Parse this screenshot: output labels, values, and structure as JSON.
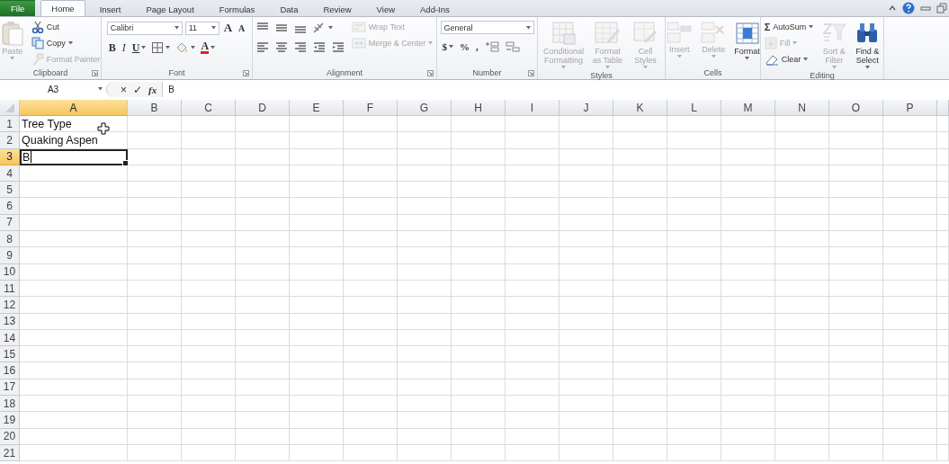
{
  "tabs": [
    {
      "label": "File",
      "kind": "file",
      "selected": false
    },
    {
      "label": "Home",
      "kind": "tab",
      "selected": true
    },
    {
      "label": "Insert",
      "kind": "tab",
      "selected": false
    },
    {
      "label": "Page Layout",
      "kind": "tab",
      "selected": false
    },
    {
      "label": "Formulas",
      "kind": "tab",
      "selected": false
    },
    {
      "label": "Data",
      "kind": "tab",
      "selected": false
    },
    {
      "label": "Review",
      "kind": "tab",
      "selected": false
    },
    {
      "label": "View",
      "kind": "tab",
      "selected": false
    },
    {
      "label": "Add-Ins",
      "kind": "tab",
      "selected": false
    }
  ],
  "ribbon": {
    "groups": [
      {
        "label": "Clipboard",
        "launcher": true,
        "columns": [
          {
            "kind": "large",
            "label": "Paste",
            "menu": true,
            "disabled": true
          },
          {
            "kind": "stack",
            "items": [
              {
                "label": "Cut",
                "menu": false,
                "disabled": false
              },
              {
                "label": "Copy",
                "menu": true,
                "disabled": false
              },
              {
                "label": "Format Painter",
                "menu": false,
                "disabled": true
              }
            ]
          }
        ]
      },
      {
        "label": "Font",
        "launcher": true,
        "columns": [
          {
            "kind": "rows",
            "rows": [
              {
                "controls": [
                  {
                    "kind": "combo",
                    "value": "Calibri"
                  },
                  {
                    "kind": "combo",
                    "value": "11"
                  },
                  {
                    "kind": "glyph",
                    "text": "A",
                    "menu": false
                  },
                  {
                    "kind": "glyph",
                    "text": "A",
                    "menu": false
                  }
                ]
              },
              {
                "controls": [
                  {
                    "kind": "glyph",
                    "text": "B",
                    "menu": false
                  },
                  {
                    "kind": "glyph",
                    "text": "I",
                    "menu": false
                  },
                  {
                    "kind": "glyph",
                    "text": "U",
                    "menu": true
                  },
                  {
                    "kind": "icon",
                    "menu": true
                  },
                  {
                    "kind": "icon",
                    "menu": true
                  },
                  {
                    "kind": "glyph",
                    "text": "A",
                    "menu": true
                  }
                ]
              }
            ]
          }
        ]
      },
      {
        "label": "Alignment",
        "launcher": true,
        "columns": [
          {
            "kind": "rows",
            "rows": [
              {
                "controls": [
                  {
                    "kind": "icon",
                    "menu": false
                  },
                  {
                    "kind": "icon",
                    "menu": false
                  },
                  {
                    "kind": "icon",
                    "menu": false
                  },
                  {
                    "kind": "icon",
                    "menu": true
                  }
                ]
              },
              {
                "controls": [
                  {
                    "kind": "icon",
                    "menu": false
                  },
                  {
                    "kind": "icon",
                    "menu": false
                  },
                  {
                    "kind": "icon",
                    "menu": false
                  },
                  {
                    "kind": "icon",
                    "menu": false
                  },
                  {
                    "kind": "icon",
                    "menu": false
                  }
                ]
              }
            ]
          },
          {
            "kind": "stack",
            "items": [
              {
                "label": "Wrap Text",
                "menu": false,
                "disabled": true
              },
              {
                "label": "Merge & Center",
                "menu": true,
                "disabled": true
              }
            ]
          }
        ]
      },
      {
        "label": "Number",
        "launcher": true,
        "columns": [
          {
            "kind": "rows",
            "rows": [
              {
                "controls": [
                  {
                    "kind": "combo",
                    "value": "General"
                  }
                ]
              },
              {
                "controls": [
                  {
                    "kind": "glyph",
                    "text": "$",
                    "menu": true
                  },
                  {
                    "kind": "glyph",
                    "text": "%",
                    "menu": false
                  },
                  {
                    "kind": "glyph",
                    "text": ",",
                    "menu": false
                  },
                  {
                    "kind": "icon",
                    "menu": false
                  },
                  {
                    "kind": "icon",
                    "menu": false
                  }
                ]
              }
            ]
          }
        ]
      },
      {
        "label": "Styles",
        "launcher": false,
        "columns": [
          {
            "kind": "large",
            "label": "Conditional Formatting",
            "menu": true,
            "disabled": true
          },
          {
            "kind": "large",
            "label": "Format as Table",
            "menu": true,
            "disabled": true
          },
          {
            "kind": "large",
            "label": "Cell Styles",
            "menu": true,
            "disabled": true
          }
        ]
      },
      {
        "label": "Cells",
        "launcher": false,
        "columns": [
          {
            "kind": "large",
            "label": "Insert",
            "menu": true,
            "disabled": true
          },
          {
            "kind": "large",
            "label": "Delete",
            "menu": true,
            "disabled": true
          },
          {
            "kind": "large",
            "label": "Format",
            "menu": true,
            "disabled": false
          }
        ]
      },
      {
        "label": "Editing",
        "launcher": false,
        "columns": [
          {
            "kind": "stack",
            "items": [
              {
                "glyph": "Σ",
                "label": "AutoSum",
                "menu": true,
                "disabled": false
              },
              {
                "label": "Fill",
                "menu": true,
                "disabled": true
              },
              {
                "label": "Clear",
                "menu": true,
                "disabled": false
              }
            ]
          },
          {
            "kind": "large",
            "label": "Sort & Filter",
            "menu": true,
            "disabled": true
          },
          {
            "kind": "large",
            "label": "Find & Select",
            "menu": true,
            "disabled": false
          }
        ]
      }
    ]
  },
  "formula_bar": {
    "name_box": "A3",
    "cancel": "×",
    "enter": "✓",
    "function": "fx",
    "value": "B"
  },
  "sheet": {
    "columns": [
      {
        "label": "A",
        "selected": true
      },
      {
        "label": "B",
        "selected": false
      },
      {
        "label": "C",
        "selected": false
      },
      {
        "label": "D",
        "selected": false
      },
      {
        "label": "E",
        "selected": false
      },
      {
        "label": "F",
        "selected": false
      },
      {
        "label": "G",
        "selected": false
      },
      {
        "label": "H",
        "selected": false
      },
      {
        "label": "I",
        "selected": false
      },
      {
        "label": "J",
        "selected": false
      },
      {
        "label": "K",
        "selected": false
      },
      {
        "label": "L",
        "selected": false
      },
      {
        "label": "M",
        "selected": false
      },
      {
        "label": "N",
        "selected": false
      },
      {
        "label": "O",
        "selected": false
      },
      {
        "label": "P",
        "selected": false
      }
    ],
    "rows": [
      {
        "label": "1",
        "selected": false,
        "cells": [
          "Tree Type"
        ]
      },
      {
        "label": "2",
        "selected": false,
        "cells": [
          "Quaking Aspen"
        ]
      },
      {
        "label": "3",
        "selected": true,
        "editing": true,
        "cells": [
          "B"
        ]
      },
      {
        "label": "4",
        "selected": false
      },
      {
        "label": "5",
        "selected": false
      },
      {
        "label": "6",
        "selected": false
      },
      {
        "label": "7",
        "selected": false
      },
      {
        "label": "8",
        "selected": false
      },
      {
        "label": "9",
        "selected": false
      },
      {
        "label": "10",
        "selected": false
      },
      {
        "label": "11",
        "selected": false
      },
      {
        "label": "12",
        "selected": false
      },
      {
        "label": "13",
        "selected": false
      },
      {
        "label": "14",
        "selected": false
      },
      {
        "label": "15",
        "selected": false
      },
      {
        "label": "16",
        "selected": false
      },
      {
        "label": "17",
        "selected": false
      },
      {
        "label": "18",
        "selected": false
      },
      {
        "label": "19",
        "selected": false
      },
      {
        "label": "20",
        "selected": false
      },
      {
        "label": "21",
        "selected": false
      }
    ]
  }
}
